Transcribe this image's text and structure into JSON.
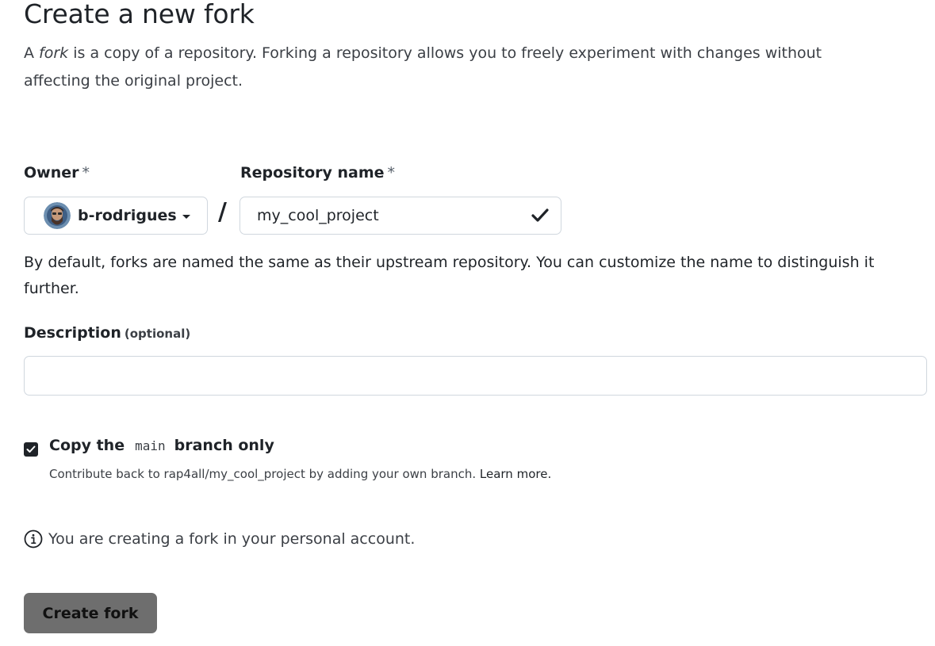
{
  "header": {
    "title": "Create a new fork",
    "subtitle_prefix": "A ",
    "subtitle_em": "fork",
    "subtitle_rest": " is a copy of a repository. Forking a repository allows you to freely experiment with changes without affecting the original project."
  },
  "owner": {
    "label": "Owner",
    "required_mark": "*",
    "selected": "b-rodrigues",
    "icons": {
      "avatar": "user-avatar",
      "caret": "triangle-down-icon"
    }
  },
  "separator": "/",
  "repository": {
    "label": "Repository name",
    "required_mark": "*",
    "value": "my_cool_project",
    "valid_icon": "check-icon"
  },
  "name_hint": "By default, forks are named the same as their upstream repository. You can customize the name to distinguish it further.",
  "description": {
    "label": "Description",
    "optional_label": "(optional)",
    "value": "",
    "placeholder": ""
  },
  "copy_branch": {
    "checked": true,
    "label_prefix": "Copy the",
    "branch": "main",
    "label_suffix": "branch only",
    "hint_prefix": "Contribute back to rap4all/my_cool_project by adding your own branch.",
    "learn_more": "Learn more."
  },
  "notice": {
    "icon": "info-icon",
    "text": "You are creating a fork in your personal account."
  },
  "actions": {
    "create_label": "Create fork"
  },
  "colors": {
    "button_bg": "#6e6e6e",
    "border": "#d0d7de",
    "text": "#1f2328"
  }
}
